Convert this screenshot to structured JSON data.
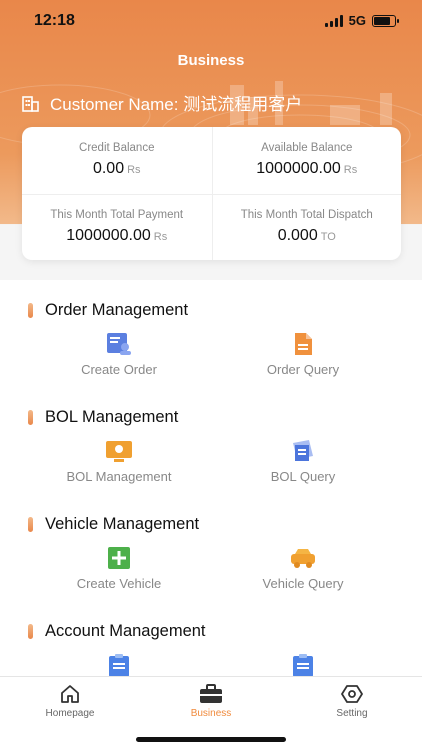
{
  "status_bar": {
    "time": "12:18",
    "network": "5G"
  },
  "header": {
    "title": "Business",
    "customer_label": "Customer Name: 测试流程用客户"
  },
  "summary": {
    "credit_balance": {
      "label": "Credit Balance",
      "value": "0.00",
      "unit": "Rs"
    },
    "available_balance": {
      "label": "Available Balance",
      "value": "1000000.00",
      "unit": "Rs"
    },
    "month_payment": {
      "label": "This Month Total Payment",
      "value": "1000000.00",
      "unit": "Rs"
    },
    "month_dispatch": {
      "label": "This Month Total Dispatch",
      "value": "0.000",
      "unit": "TO"
    }
  },
  "sections": {
    "order": {
      "title": "Order Management",
      "left": "Create Order",
      "right": "Order Query"
    },
    "bol": {
      "title": "BOL Management",
      "left": "BOL Management",
      "right": "BOL Query"
    },
    "vehicle": {
      "title": "Vehicle Management",
      "left": "Create Vehicle",
      "right": "Vehicle Query"
    },
    "account": {
      "title": "Account Management"
    }
  },
  "tabs": {
    "home": "Homepage",
    "business": "Business",
    "setting": "Setting"
  },
  "colors": {
    "accent": "#e9874a",
    "active_tab": "#f08a3c",
    "header_gradient_end": "#f2b98a"
  }
}
